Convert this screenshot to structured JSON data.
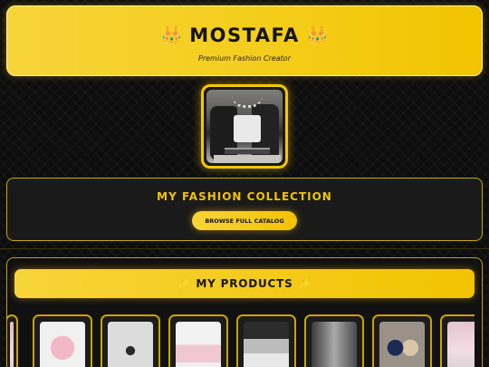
{
  "header": {
    "crown_left": "👑",
    "title": "MOSTAFA",
    "crown_right": "👑",
    "subtitle": "Premium Fashion Creator"
  },
  "collection": {
    "heading": "MY FASHION COLLECTION",
    "button_label": "BROWSE FULL CATALOG"
  },
  "products": {
    "sparkle_left": "✨",
    "heading": "MY PRODUCTS",
    "sparkle_right": "✨"
  },
  "colors": {
    "accent": "#f2c300",
    "background": "#0d0d0d",
    "panel": "#1a1a1a"
  }
}
